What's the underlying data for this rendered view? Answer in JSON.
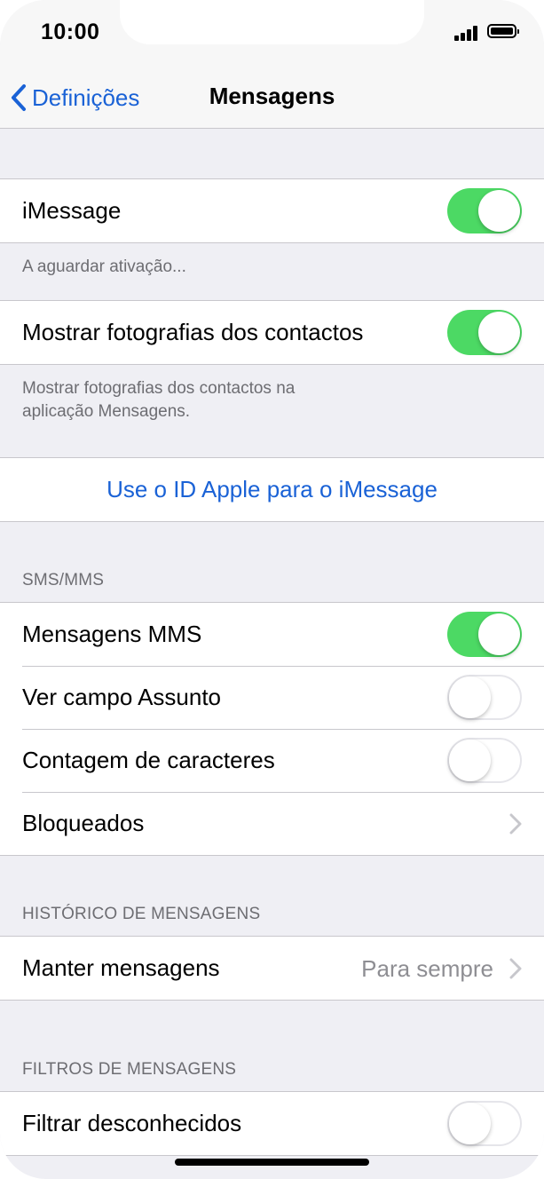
{
  "status_bar": {
    "time": "10:00",
    "signal_icon": "cellular-signal-icon",
    "battery_icon": "battery-icon"
  },
  "nav": {
    "back_label": "Definições",
    "title": "Mensagens"
  },
  "imessage": {
    "label": "iMessage",
    "enabled": true,
    "footer": "A aguardar ativação..."
  },
  "contact_photos": {
    "label": "Mostrar fotografias dos contactos",
    "enabled": true,
    "footer_line1": "Mostrar fotografias dos contactos na",
    "footer_line2": "aplicação Mensagens."
  },
  "apple_id": {
    "link_label": "Use o ID Apple para o iMessage"
  },
  "sms_mms": {
    "header": "SMS/MMS",
    "mms_label": "Mensagens MMS",
    "mms_enabled": true,
    "subject_label": "Ver campo Assunto",
    "subject_enabled": false,
    "char_count_label": "Contagem de caracteres",
    "char_count_enabled": false,
    "blocked_label": "Bloqueados"
  },
  "history": {
    "header": "HISTÓRICO DE MENSAGENS",
    "keep_label": "Manter mensagens",
    "keep_value": "Para sempre"
  },
  "filters": {
    "header": "FILTROS DE MENSAGENS",
    "filter_unknown_label": "Filtrar desconhecidos",
    "filter_unknown_enabled": false
  },
  "colors": {
    "accent": "#1a62d6",
    "toggle_on": "#4cd964",
    "background": "#efeff4"
  }
}
